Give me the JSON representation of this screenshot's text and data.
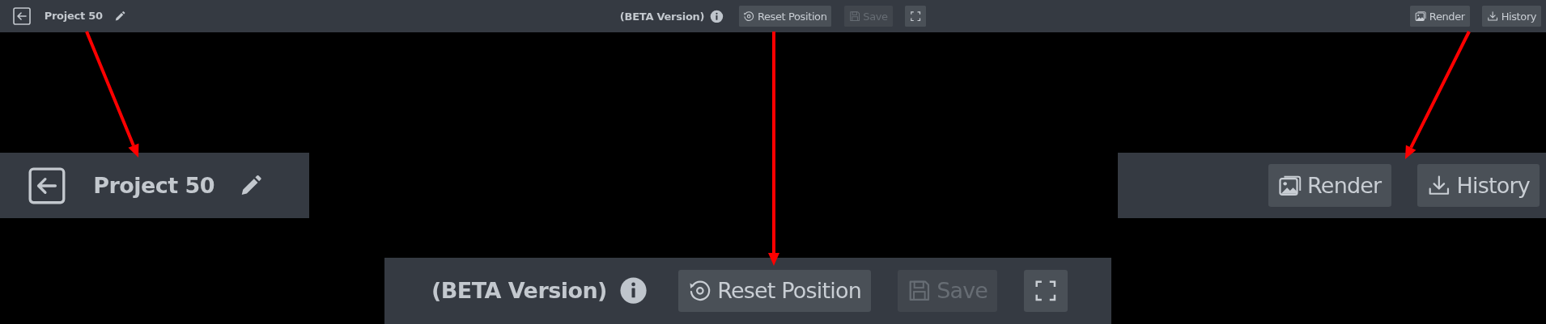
{
  "toolbar": {
    "left": {
      "project_name": "Project 50"
    },
    "center": {
      "beta_label": "(BETA Version)",
      "buttons": [
        {
          "kind": "reset",
          "label": "Reset Position",
          "disabled": false
        },
        {
          "kind": "save",
          "label": "Save",
          "disabled": true
        },
        {
          "kind": "fullscreen",
          "disabled": false
        }
      ]
    },
    "right": {
      "buttons": [
        {
          "kind": "render",
          "label": "Render",
          "disabled": false
        },
        {
          "kind": "history",
          "label": "History",
          "disabled": false
        }
      ]
    }
  },
  "callouts": [
    {
      "kind": "left",
      "project_name": "Project 50"
    },
    {
      "kind": "center",
      "beta_label": "(BETA Version)",
      "buttons": [
        {
          "kind": "reset",
          "label": "Reset Position",
          "disabled": false
        },
        {
          "kind": "save",
          "label": "Save",
          "disabled": true
        },
        {
          "kind": "fullscreen",
          "disabled": false
        }
      ]
    },
    {
      "kind": "right",
      "buttons": [
        {
          "kind": "render",
          "label": "Render",
          "disabled": false
        },
        {
          "kind": "history",
          "label": "History",
          "disabled": false
        }
      ]
    }
  ]
}
